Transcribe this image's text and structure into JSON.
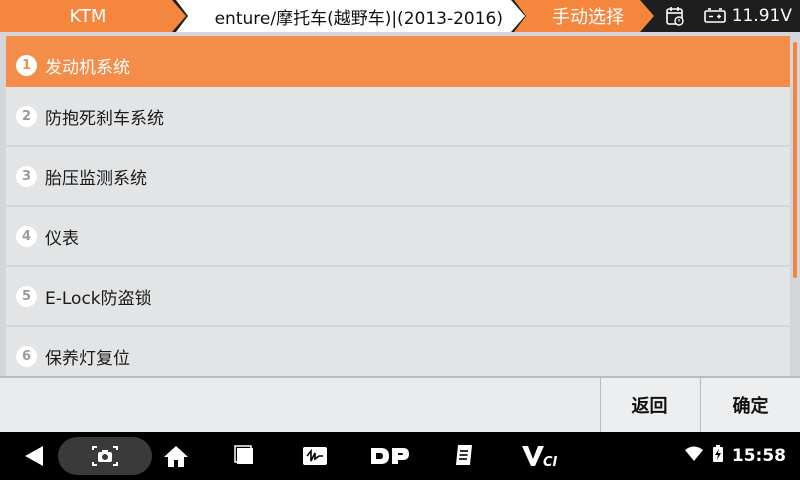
{
  "header": {
    "breadcrumbs": [
      "KTM",
      "enture/摩托车(越野车)|(2013-2016)",
      "手动选择"
    ],
    "voltage": "11.91V"
  },
  "menu": {
    "items": [
      {
        "number": "1",
        "label": "发动机系统",
        "selected": true
      },
      {
        "number": "2",
        "label": "防抱死刹车系统",
        "selected": false
      },
      {
        "number": "3",
        "label": "胎压监测系统",
        "selected": false
      },
      {
        "number": "4",
        "label": "仪表",
        "selected": false
      },
      {
        "number": "5",
        "label": "E-Lock防盗锁",
        "selected": false
      },
      {
        "number": "6",
        "label": "保养灯复位",
        "selected": false
      }
    ]
  },
  "actions": {
    "back_label": "返回",
    "ok_label": "确定"
  },
  "statusbar": {
    "time": "15:58"
  },
  "colors": {
    "accent": "#f4873d",
    "selected_row": "#f48d4a",
    "row": "#e2e4e6"
  },
  "icons": [
    "calendar-icon",
    "battery-icon",
    "back-nav-icon",
    "screenshot-icon",
    "home-icon",
    "recents-icon",
    "scope-app-icon",
    "dp-app-icon",
    "manual-app-icon",
    "vci-app-icon",
    "wifi-icon",
    "battery-charging-icon"
  ]
}
